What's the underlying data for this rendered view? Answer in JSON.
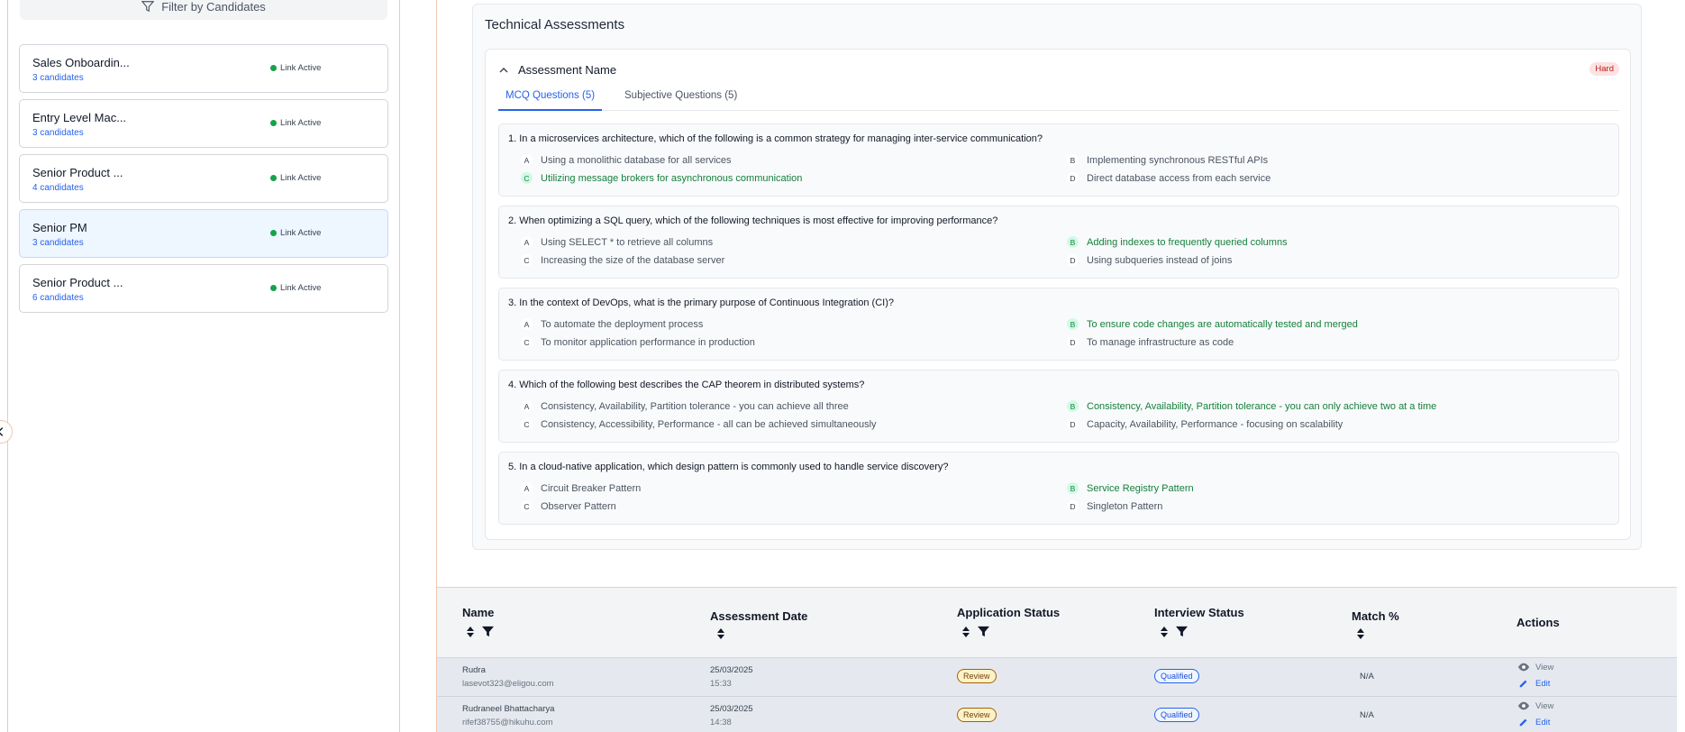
{
  "sidebar": {
    "filter_label": "Filter by Candidates",
    "jobs": [
      {
        "title": "Sales Onboardin...",
        "count": "3 candidates",
        "status": "Link Active"
      },
      {
        "title": "Entry Level Mac...",
        "count": "3 candidates",
        "status": "Link Active"
      },
      {
        "title": "Senior Product ...",
        "count": "4 candidates",
        "status": "Link Active"
      },
      {
        "title": "Senior PM",
        "count": "3 candidates",
        "status": "Link Active"
      },
      {
        "title": "Senior Product ...",
        "count": "6 candidates",
        "status": "Link Active"
      }
    ]
  },
  "assessment": {
    "section_title": "Technical Assessments",
    "name": "Assessment Name",
    "difficulty": "Hard",
    "tabs": [
      "MCQ Questions (5)",
      "Subjective Questions (5)"
    ],
    "questions": [
      {
        "text": "1. In a microservices architecture, which of the following is a common strategy for managing inter-service communication?",
        "a": "Using a monolithic database for all services",
        "b": "Implementing synchronous RESTful APIs",
        "c": "Utilizing message brokers for asynchronous communication",
        "d": "Direct database access from each service",
        "correct": "c"
      },
      {
        "text": "2. When optimizing a SQL query, which of the following techniques is most effective for improving performance?",
        "a": "Using SELECT * to retrieve all columns",
        "b": "Adding indexes to frequently queried columns",
        "c": "Increasing the size of the database server",
        "d": "Using subqueries instead of joins",
        "correct": "b"
      },
      {
        "text": "3. In the context of DevOps, what is the primary purpose of Continuous Integration (CI)?",
        "a": "To automate the deployment process",
        "b": "To ensure code changes are automatically tested and merged",
        "c": "To monitor application performance in production",
        "d": "To manage infrastructure as code",
        "correct": "b"
      },
      {
        "text": "4. Which of the following best describes the CAP theorem in distributed systems?",
        "a": "Consistency, Availability, Partition tolerance - you can achieve all three",
        "b": "Consistency, Availability, Partition tolerance - you can only achieve two at a time",
        "c": "Consistency, Accessibility, Performance - all can be achieved simultaneously",
        "d": "Capacity, Availability, Performance - focusing on scalability",
        "correct": "b"
      },
      {
        "text": "5. In a cloud-native application, which design pattern is commonly used to handle service discovery?",
        "a": "Circuit Breaker Pattern",
        "b": "Service Registry Pattern",
        "c": "Observer Pattern",
        "d": "Singleton Pattern",
        "correct": "b"
      }
    ]
  },
  "table": {
    "headers": [
      "Name",
      "Assessment Date",
      "Application Status",
      "Interview Status",
      "Match %",
      "Actions"
    ],
    "rows": [
      {
        "name": "Rudra",
        "email": "lasevot323@eligou.com",
        "date": "25/03/2025",
        "time": "15:33",
        "app_status": "Review",
        "int_status": "Qualified",
        "match": "N/A",
        "view": "View",
        "edit": "Edit"
      },
      {
        "name": "Rudraneel Bhattacharya",
        "email": "rifef38755@hikuhu.com",
        "date": "25/03/2025",
        "time": "14:38",
        "app_status": "Review",
        "int_status": "Qualified",
        "match": "N/A",
        "view": "View",
        "edit": "Edit"
      }
    ]
  },
  "letters": {
    "a": "A",
    "b": "B",
    "c": "C",
    "d": "D"
  }
}
